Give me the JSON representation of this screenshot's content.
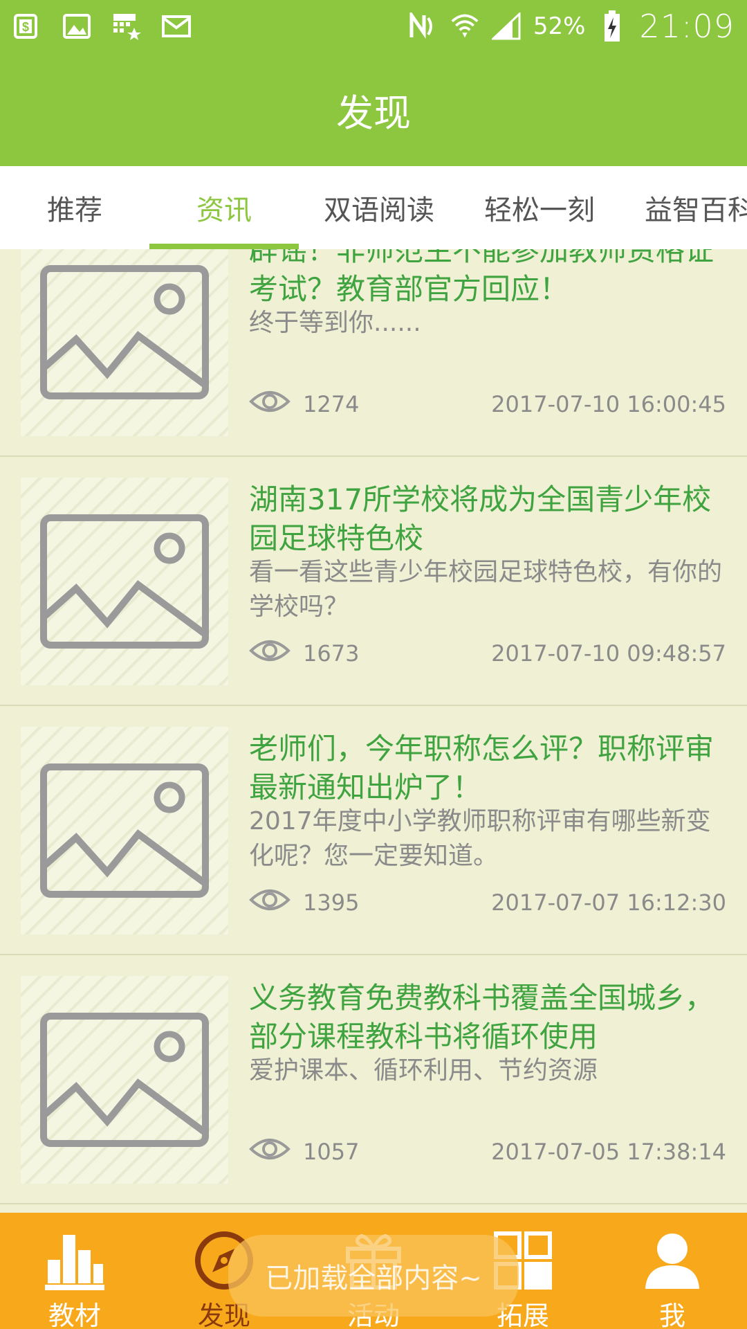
{
  "status_bar": {
    "battery": "52%",
    "time": "21:09",
    "left_icons": [
      "s-app-icon",
      "image-icon",
      "calendar-icon",
      "mail-icon"
    ],
    "right_icons": [
      "nfc-icon",
      "wifi-icon",
      "signal-icon",
      "battery-charging-icon"
    ]
  },
  "header": {
    "title": "发现"
  },
  "tabs": [
    {
      "label": "推荐",
      "active": false
    },
    {
      "label": "资讯",
      "active": true
    },
    {
      "label": "双语阅读",
      "active": false
    },
    {
      "label": "轻松一刻",
      "active": false
    },
    {
      "label": "益智百科",
      "active": false
    }
  ],
  "articles": [
    {
      "title": "辟谣！非师范生不能参加教师资格证考试？教育部官方回应！",
      "desc": "终于等到你......",
      "views": "1274",
      "date": "2017-07-10 16:00:45"
    },
    {
      "title": "湖南317所学校将成为全国青少年校园足球特色校",
      "desc": "看一看这些青少年校园足球特色校，有你的学校吗？",
      "views": "1673",
      "date": "2017-07-10 09:48:57"
    },
    {
      "title": "老师们，今年职称怎么评？职称评审最新通知出炉了！",
      "desc": "2017年度中小学教师职称评审有哪些新变化呢？您一定要知道。",
      "views": "1395",
      "date": "2017-07-07 16:12:30"
    },
    {
      "title": "义务教育免费教科书覆盖全国城乡，部分课程教科书将循环使用",
      "desc": "爱护课本、循环利用、节约资源",
      "views": "1057",
      "date": "2017-07-05 17:38:14"
    }
  ],
  "toast": "已加载全部内容~",
  "bottom_nav": [
    {
      "label": "教材",
      "icon": "bar-chart-icon",
      "active": false
    },
    {
      "label": "发现",
      "icon": "compass-icon",
      "active": true
    },
    {
      "label": "活动",
      "icon": "gift-icon",
      "active": false
    },
    {
      "label": "拓展",
      "icon": "grid-icon",
      "active": false
    },
    {
      "label": "我",
      "icon": "user-icon",
      "active": false
    }
  ],
  "colors": {
    "header_green": "#8dc63f",
    "title_green": "#3fa33f",
    "list_bg": "#eff0d4",
    "nav_orange": "#f8a91b",
    "nav_active": "#8a3a0c"
  }
}
